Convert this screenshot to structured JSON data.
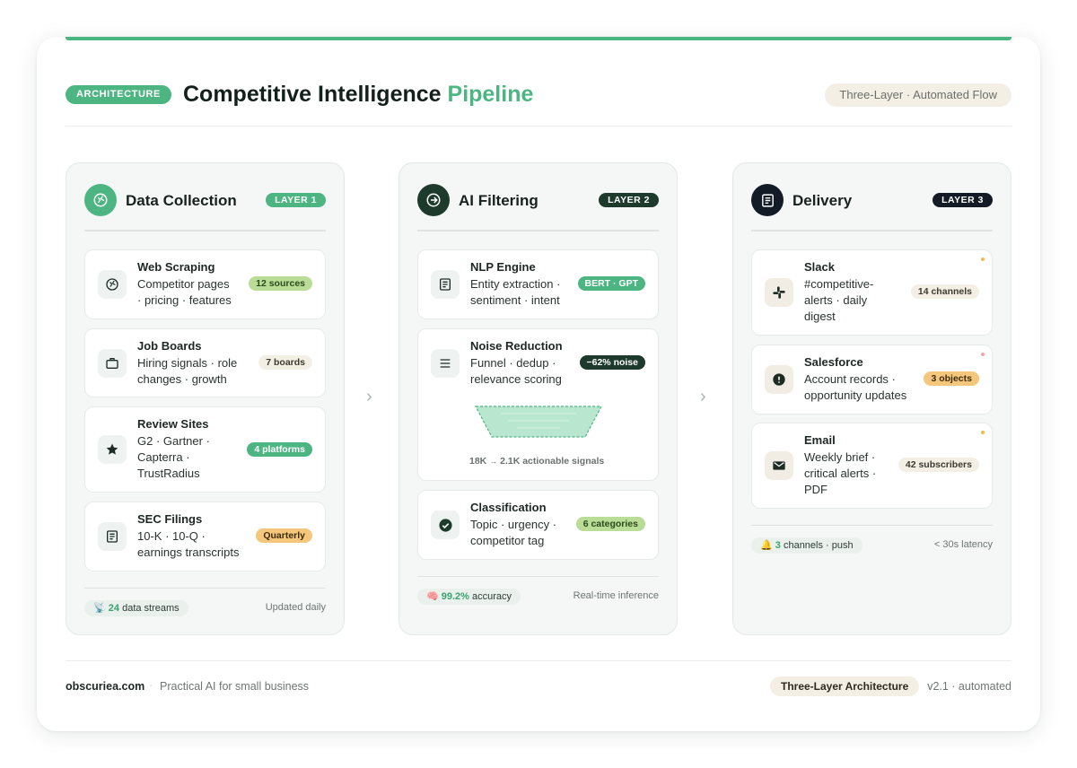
{
  "header": {
    "badge": "ARCHITECTURE",
    "title_main": "Competitive Intelligence",
    "title_accent": "Pipeline",
    "flow_pill": "Three-Layer · Automated Flow"
  },
  "colors": {
    "accent": "#4db582",
    "dark": "#1d3a2c",
    "navy": "#131c26",
    "amber": "#f5c77c",
    "light_green": "#b9dc96",
    "beige": "#f4efe4"
  },
  "layers": [
    {
      "title": "Data Collection",
      "badge": "LAYER 1",
      "icon": "globe-icon",
      "items": [
        {
          "title": "Web Scraping",
          "desc": [
            "Competitor pages",
            "· pricing · features"
          ],
          "tag": "12 sources",
          "icon": "globe-icon"
        },
        {
          "title": "Job Boards",
          "desc": [
            "Hiring signals · role",
            "changes · growth"
          ],
          "tag": "7 boards",
          "icon": "briefcase-icon"
        },
        {
          "title": "Review Sites",
          "desc": [
            "G2 · Gartner ·",
            "Capterra ·",
            "TrustRadius"
          ],
          "tag": "4 platforms",
          "icon": "star-icon"
        },
        {
          "title": "SEC Filings",
          "desc": [
            "10-K · 10-Q ·",
            "earnings transcripts"
          ],
          "tag": "Quarterly",
          "icon": "document-icon"
        }
      ],
      "footer": {
        "icon": "📡",
        "count": "24",
        "label": "data streams",
        "right": "Updated daily"
      }
    },
    {
      "title": "AI Filtering",
      "badge": "LAYER 2",
      "icon": "arrow-circle-icon",
      "items": [
        {
          "title": "NLP Engine",
          "desc": [
            "Entity extraction ·",
            "sentiment · intent"
          ],
          "tag": "BERT · GPT",
          "icon": "document-icon"
        },
        {
          "title": "Noise Reduction",
          "desc": [
            "Funnel · dedup ·",
            "relevance scoring"
          ],
          "tag": "−62% noise",
          "icon": "menu-icon"
        },
        {
          "title": "Classification",
          "desc": [
            "Topic · urgency ·",
            "competitor tag"
          ],
          "tag": "6 categories",
          "icon": "check-circle-icon"
        }
      ],
      "funnel": {
        "from": "18K",
        "arrow": "→",
        "to": "2.1K actionable signals"
      },
      "footer": {
        "icon": "🧠",
        "count": "99.2%",
        "label": "accuracy",
        "right": "Real-time inference"
      }
    },
    {
      "title": "Delivery",
      "badge": "LAYER 3",
      "icon": "document-icon",
      "items": [
        {
          "title": "Slack",
          "desc": [
            "#competitive-",
            "alerts · daily",
            "digest"
          ],
          "tag": "14 channels",
          "icon": "slack-icon"
        },
        {
          "title": "Salesforce",
          "desc": [
            "Account records ·",
            "opportunity updates"
          ],
          "tag": "3 objects",
          "icon": "alert-icon"
        },
        {
          "title": "Email",
          "desc": [
            "Weekly brief ·",
            "critical alerts ·",
            "PDF"
          ],
          "tag": "42 subscribers",
          "icon": "mail-icon"
        }
      ],
      "footer": {
        "icon": "🔔",
        "count": "3",
        "label": "channels · push",
        "right": "< 30s latency"
      }
    }
  ],
  "footer": {
    "brand": "obscuriea.com",
    "separator": "·",
    "tagline": "Practical AI for small business",
    "arch_pill": "Three-Layer Architecture",
    "version": "v2.1 · automated"
  }
}
